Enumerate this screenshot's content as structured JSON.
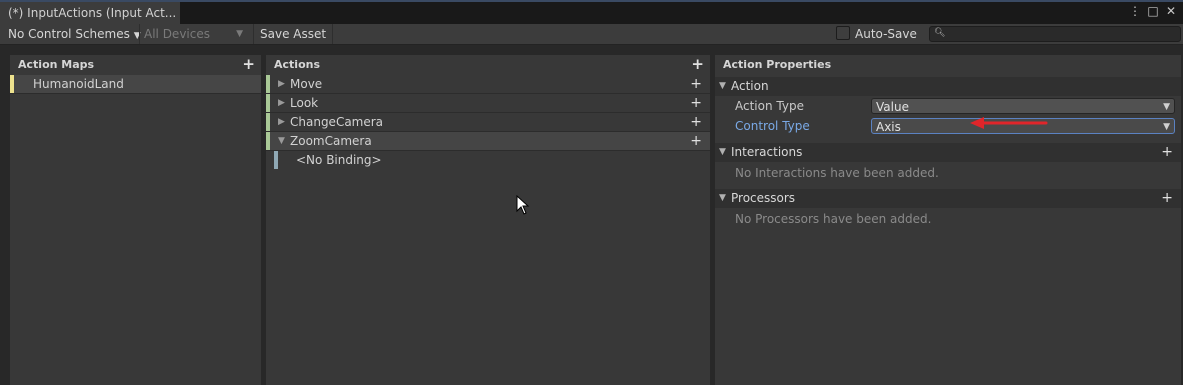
{
  "window": {
    "tab_title": "(*) InputActions (Input Act...",
    "tab_controls": [
      "⋮",
      "□",
      "✕"
    ]
  },
  "toolbar": {
    "control_schemes": "No Control Schemes",
    "devices": "All Devices",
    "save_asset": "Save Asset",
    "auto_save": "Auto-Save",
    "search_value": ""
  },
  "action_maps": {
    "header": "Action Maps",
    "items": [
      {
        "label": "HumanoidLand",
        "selected": true
      }
    ]
  },
  "actions": {
    "header": "Actions",
    "items": [
      {
        "label": "Move",
        "expanded": false
      },
      {
        "label": "Look",
        "expanded": false
      },
      {
        "label": "ChangeCamera",
        "expanded": false
      },
      {
        "label": "ZoomCamera",
        "expanded": true
      }
    ],
    "binding": "<No Binding>"
  },
  "properties": {
    "header": "Action Properties",
    "action_section": "Action",
    "action_type_label": "Action Type",
    "action_type_value": "Value",
    "control_type_label": "Control Type",
    "control_type_value": "Axis",
    "interactions_section": "Interactions",
    "interactions_empty": "No Interactions have been added.",
    "processors_section": "Processors",
    "processors_empty": "No Processors have been added."
  },
  "colors": {
    "map_accent": "#ede28e",
    "action_accent": "#a9c896",
    "binding_accent": "#8fa8b4",
    "annotation_arrow": "#e0252a"
  }
}
